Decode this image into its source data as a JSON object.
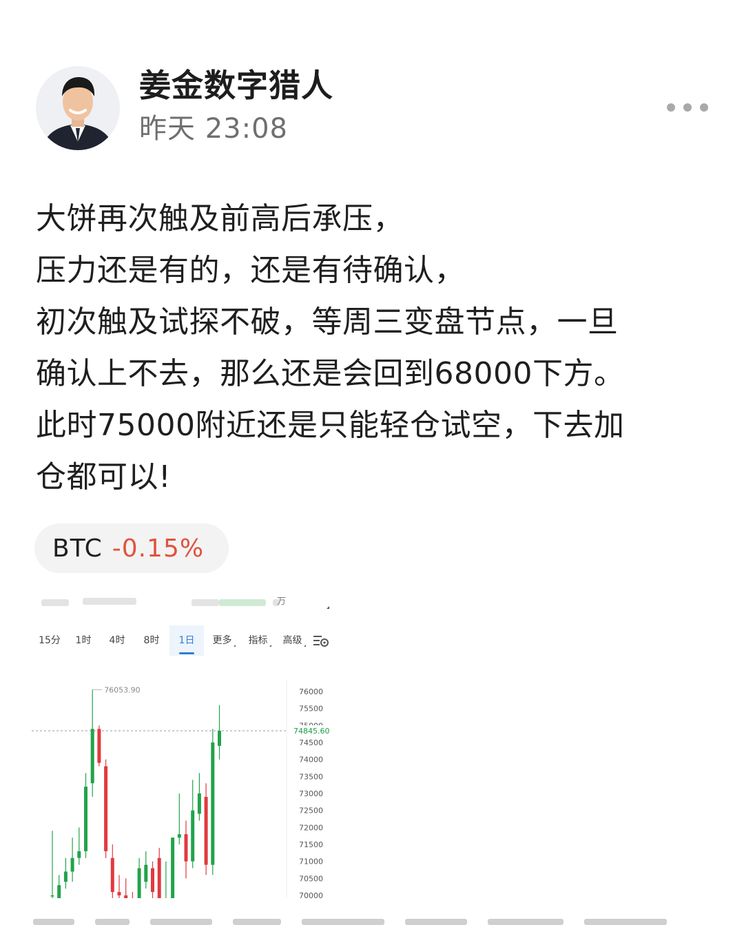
{
  "author": {
    "name": "姜金数字猎人",
    "time": "昨天 23:08",
    "avatar_icon": "person-portrait-icon"
  },
  "more_icon": "more-dots-icon",
  "post": {
    "lines": [
      "大饼再次触及前高后承压，",
      "压力还是有的，还是有待确认，",
      "初次触及试探不破，等周三变盘节点，一旦",
      "确认上不去，那么还是会回到68000下方。",
      "此时75000附近还是只能轻仓试空，下去加",
      "仓都可以!"
    ]
  },
  "ticker": {
    "symbol": "BTC",
    "change": "-0.15%",
    "change_color": "#e0533d"
  },
  "screenshot": {
    "top_text": "万",
    "timeframes": [
      "15分",
      "1时",
      "4时",
      "8时",
      "1日",
      "更多",
      "指标",
      "高级"
    ],
    "active_timeframe": "1日",
    "settings_icon": "chart-settings-icon",
    "up_color": "#22a34a",
    "down_color": "#e03a3e",
    "chart_data": {
      "type": "candlestick",
      "title": "",
      "ylim": [
        70000,
        76000
      ],
      "y_ticks": [
        "76000",
        "75500",
        "75000",
        "74500",
        "74000",
        "73500",
        "73000",
        "72500",
        "72000",
        "71500",
        "71000",
        "70500",
        "70000"
      ],
      "high_label": "76053.90",
      "current_price": "74845.60",
      "current_price_value": 74845.6,
      "candles": [
        {
          "o": 70000,
          "h": 71900,
          "l": 69800,
          "c": 70000
        },
        {
          "o": 69900,
          "h": 70600,
          "l": 69600,
          "c": 70300
        },
        {
          "o": 70400,
          "h": 71100,
          "l": 70200,
          "c": 70700
        },
        {
          "o": 70700,
          "h": 71700,
          "l": 70400,
          "c": 71100
        },
        {
          "o": 71100,
          "h": 72000,
          "l": 70900,
          "c": 71300
        },
        {
          "o": 71300,
          "h": 73600,
          "l": 71100,
          "c": 73200
        },
        {
          "o": 73300,
          "h": 76054,
          "l": 72900,
          "c": 74900
        },
        {
          "o": 74900,
          "h": 75000,
          "l": 73800,
          "c": 73900
        },
        {
          "o": 73800,
          "h": 74000,
          "l": 71100,
          "c": 71300
        },
        {
          "o": 71100,
          "h": 71500,
          "l": 69800,
          "c": 70100
        },
        {
          "o": 70100,
          "h": 70600,
          "l": 69500,
          "c": 70000
        },
        {
          "o": 70000,
          "h": 70500,
          "l": 69500,
          "c": 69800
        },
        {
          "o": 69800,
          "h": 70100,
          "l": 69300,
          "c": 69500
        },
        {
          "o": 69700,
          "h": 71100,
          "l": 69600,
          "c": 70800
        },
        {
          "o": 70400,
          "h": 71300,
          "l": 70200,
          "c": 70900
        },
        {
          "o": 70800,
          "h": 71000,
          "l": 69800,
          "c": 70100
        },
        {
          "o": 71100,
          "h": 71400,
          "l": 69700,
          "c": 69900
        },
        {
          "o": 69700,
          "h": 71000,
          "l": 69500,
          "c": 69800
        },
        {
          "o": 69800,
          "h": 71700,
          "l": 69600,
          "c": 71700
        },
        {
          "o": 71700,
          "h": 73000,
          "l": 71500,
          "c": 71800
        },
        {
          "o": 71800,
          "h": 72200,
          "l": 70500,
          "c": 71000
        },
        {
          "o": 71000,
          "h": 73400,
          "l": 70800,
          "c": 72500
        },
        {
          "o": 72400,
          "h": 73600,
          "l": 72200,
          "c": 73000
        },
        {
          "o": 72900,
          "h": 73300,
          "l": 70600,
          "c": 70900
        },
        {
          "o": 70900,
          "h": 74900,
          "l": 70600,
          "c": 74500
        },
        {
          "o": 74400,
          "h": 75600,
          "l": 74000,
          "c": 74846
        }
      ]
    }
  }
}
